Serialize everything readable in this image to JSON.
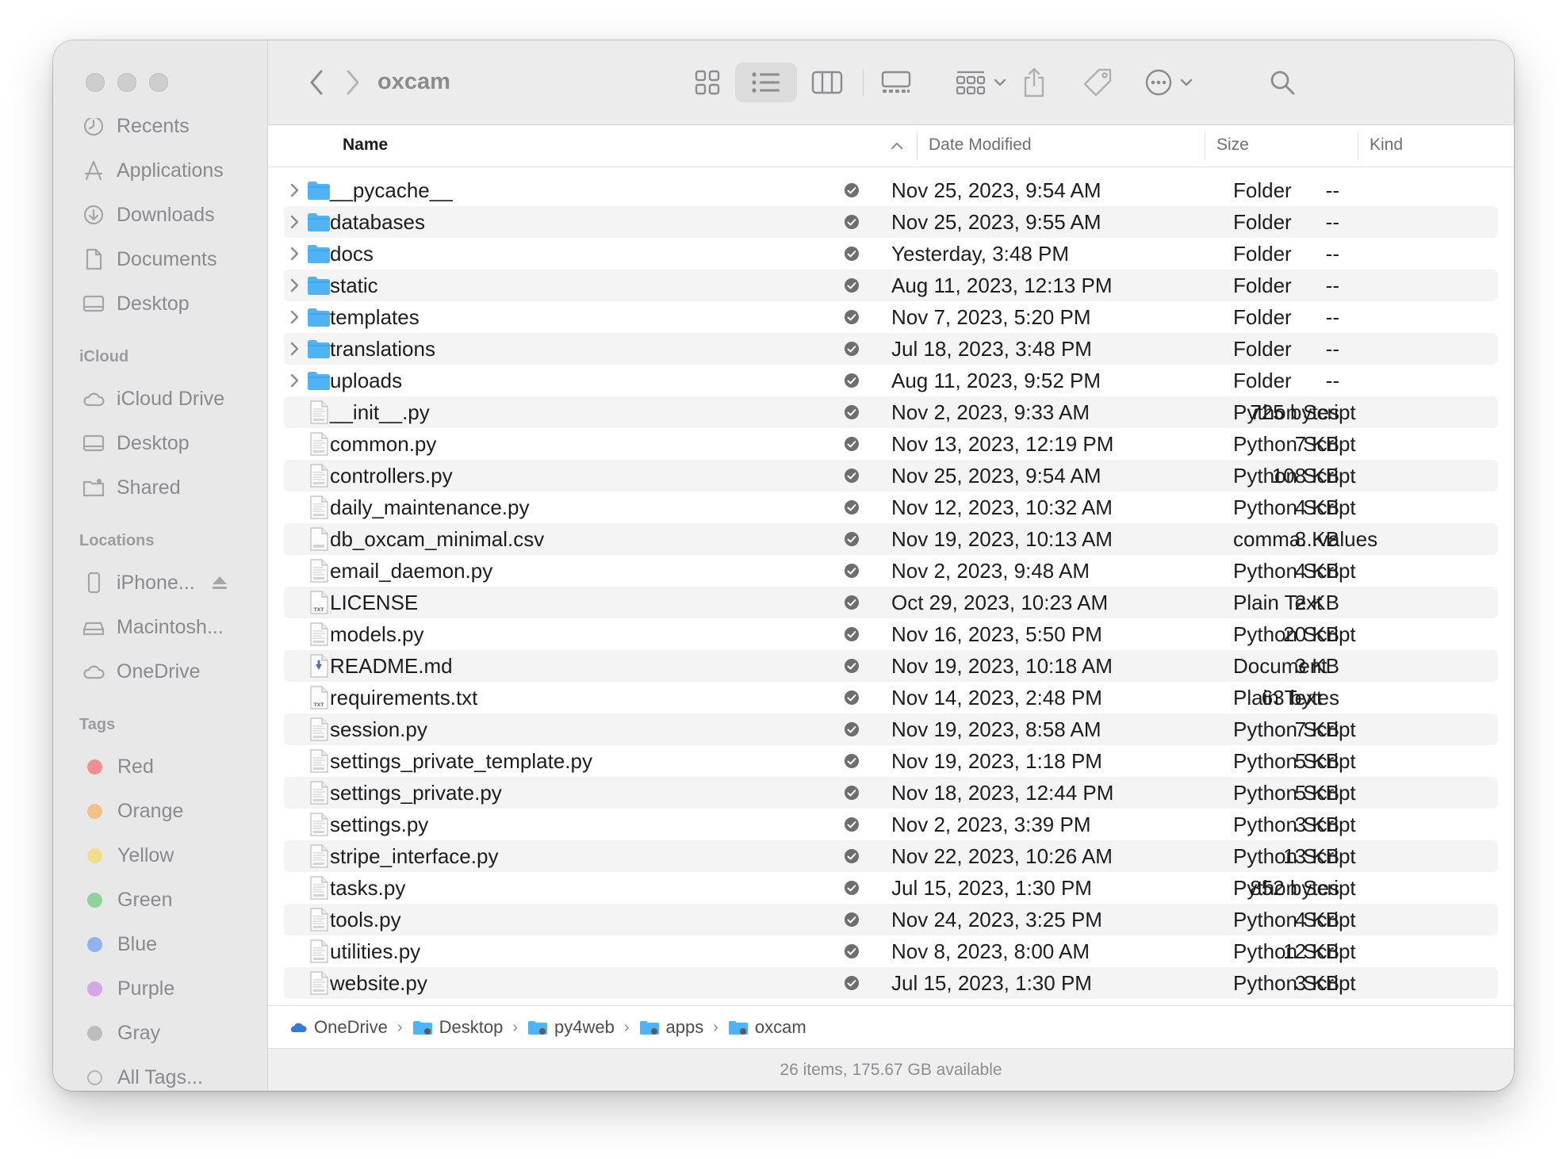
{
  "window": {
    "title": "oxcam"
  },
  "sidebar": {
    "favorites": [
      {
        "label": "Recents",
        "icon": "clock-icon"
      },
      {
        "label": "Applications",
        "icon": "applications-icon"
      },
      {
        "label": "Downloads",
        "icon": "download-icon"
      },
      {
        "label": "Documents",
        "icon": "document-icon"
      },
      {
        "label": "Desktop",
        "icon": "desktop-icon"
      }
    ],
    "icloud_heading": "iCloud",
    "icloud": [
      {
        "label": "iCloud Drive",
        "icon": "cloud-icon"
      },
      {
        "label": "Desktop",
        "icon": "desktop-icon"
      },
      {
        "label": "Shared",
        "icon": "shared-folder-icon"
      }
    ],
    "locations_heading": "Locations",
    "locations": [
      {
        "label": "iPhone...",
        "icon": "iphone-icon",
        "eject": true
      },
      {
        "label": "Macintosh...",
        "icon": "disk-icon"
      },
      {
        "label": "OneDrive",
        "icon": "cloud-icon"
      }
    ],
    "tags_heading": "Tags",
    "tags": [
      {
        "label": "Red",
        "color": "#f1908f"
      },
      {
        "label": "Orange",
        "color": "#f2c08a"
      },
      {
        "label": "Yellow",
        "color": "#f2dd8d"
      },
      {
        "label": "Green",
        "color": "#8fd39a"
      },
      {
        "label": "Blue",
        "color": "#8fb3f0"
      },
      {
        "label": "Purple",
        "color": "#d6a6e6"
      },
      {
        "label": "Gray",
        "color": "#bdbdbf"
      },
      {
        "label": "All Tags...",
        "color": ""
      }
    ]
  },
  "columns": {
    "name": "Name",
    "date": "Date Modified",
    "size": "Size",
    "kind": "Kind"
  },
  "files": [
    {
      "name": "__pycache__",
      "date": "Nov 25, 2023, 9:54 AM",
      "size": "--",
      "kind": "Folder",
      "type": "folder"
    },
    {
      "name": "databases",
      "date": "Nov 25, 2023, 9:55 AM",
      "size": "--",
      "kind": "Folder",
      "type": "folder"
    },
    {
      "name": "docs",
      "date": "Yesterday, 3:48 PM",
      "size": "--",
      "kind": "Folder",
      "type": "folder"
    },
    {
      "name": "static",
      "date": "Aug 11, 2023, 12:13 PM",
      "size": "--",
      "kind": "Folder",
      "type": "folder"
    },
    {
      "name": "templates",
      "date": "Nov 7, 2023, 5:20 PM",
      "size": "--",
      "kind": "Folder",
      "type": "folder"
    },
    {
      "name": "translations",
      "date": "Jul 18, 2023, 3:48 PM",
      "size": "--",
      "kind": "Folder",
      "type": "folder"
    },
    {
      "name": "uploads",
      "date": "Aug 11, 2023, 9:52 PM",
      "size": "--",
      "kind": "Folder",
      "type": "folder"
    },
    {
      "name": "__init__.py",
      "date": "Nov 2, 2023, 9:33 AM",
      "size": "725 bytes",
      "kind": "Python Script",
      "type": "py"
    },
    {
      "name": "common.py",
      "date": "Nov 13, 2023, 12:19 PM",
      "size": "7 KB",
      "kind": "Python Script",
      "type": "py"
    },
    {
      "name": "controllers.py",
      "date": "Nov 25, 2023, 9:54 AM",
      "size": "108 KB",
      "kind": "Python Script",
      "type": "py"
    },
    {
      "name": "daily_maintenance.py",
      "date": "Nov 12, 2023, 10:32 AM",
      "size": "4 KB",
      "kind": "Python Script",
      "type": "py"
    },
    {
      "name": "db_oxcam_minimal.csv",
      "date": "Nov 19, 2023, 10:13 AM",
      "size": "8 KB",
      "kind": "comma...values",
      "type": "csv"
    },
    {
      "name": "email_daemon.py",
      "date": "Nov 2, 2023, 9:48 AM",
      "size": "4 KB",
      "kind": "Python Script",
      "type": "py"
    },
    {
      "name": "LICENSE",
      "date": "Oct 29, 2023, 10:23 AM",
      "size": "2 KB",
      "kind": "Plain Text",
      "type": "txt"
    },
    {
      "name": "models.py",
      "date": "Nov 16, 2023, 5:50 PM",
      "size": "20 KB",
      "kind": "Python Script",
      "type": "py"
    },
    {
      "name": "README.md",
      "date": "Nov 19, 2023, 10:18 AM",
      "size": "3 KB",
      "kind": "Document",
      "type": "md"
    },
    {
      "name": "requirements.txt",
      "date": "Nov 14, 2023, 2:48 PM",
      "size": "63 bytes",
      "kind": "Plain Text",
      "type": "txt"
    },
    {
      "name": "session.py",
      "date": "Nov 19, 2023, 8:58 AM",
      "size": "7 KB",
      "kind": "Python Script",
      "type": "py"
    },
    {
      "name": "settings_private_template.py",
      "date": "Nov 19, 2023, 1:18 PM",
      "size": "5 KB",
      "kind": "Python Script",
      "type": "py"
    },
    {
      "name": "settings_private.py",
      "date": "Nov 18, 2023, 12:44 PM",
      "size": "5 KB",
      "kind": "Python Script",
      "type": "py"
    },
    {
      "name": "settings.py",
      "date": "Nov 2, 2023, 3:39 PM",
      "size": "3 KB",
      "kind": "Python Script",
      "type": "py"
    },
    {
      "name": "stripe_interface.py",
      "date": "Nov 22, 2023, 10:26 AM",
      "size": "13 KB",
      "kind": "Python Script",
      "type": "py"
    },
    {
      "name": "tasks.py",
      "date": "Jul 15, 2023, 1:30 PM",
      "size": "852 bytes",
      "kind": "Python Script",
      "type": "py"
    },
    {
      "name": "tools.py",
      "date": "Nov 24, 2023, 3:25 PM",
      "size": "4 KB",
      "kind": "Python Script",
      "type": "py"
    },
    {
      "name": "utilities.py",
      "date": "Nov 8, 2023, 8:00 AM",
      "size": "12 KB",
      "kind": "Python Script",
      "type": "py"
    },
    {
      "name": "website.py",
      "date": "Jul 15, 2023, 1:30 PM",
      "size": "3 KB",
      "kind": "Python Script",
      "type": "py"
    }
  ],
  "path": [
    {
      "label": "OneDrive",
      "icon": "onedrive-icon"
    },
    {
      "label": "Desktop",
      "icon": "folder-icon"
    },
    {
      "label": "py4web",
      "icon": "folder-icon"
    },
    {
      "label": "apps",
      "icon": "folder-icon"
    },
    {
      "label": "oxcam",
      "icon": "folder-icon"
    }
  ],
  "path_separator": "›",
  "status": {
    "text": "26 items, 175.67 GB available"
  },
  "colors": {
    "folder": "#4fb3f5",
    "sync_badge": "#6e6e71",
    "accent": "#8c8c8e"
  }
}
